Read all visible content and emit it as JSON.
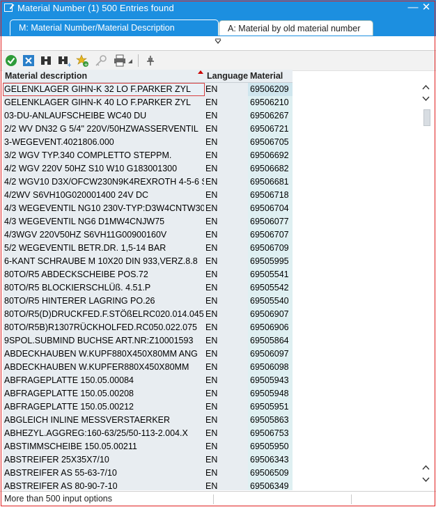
{
  "window": {
    "title": "Material Number (1)  500 Entries found",
    "minimize_glyph": "—",
    "close_glyph": "✕"
  },
  "tabs": [
    {
      "label": "M: Material Number/Material Description",
      "active": true
    },
    {
      "label": "A: Material by old material number",
      "active": false
    }
  ],
  "toolbar_icons": [
    "check-icon",
    "cancel-icon",
    "binoculars-icon",
    "find-next-icon",
    "add-favorite-icon",
    "key-icon",
    "print-icon",
    "dropdown-arrow-icon",
    "pin-icon"
  ],
  "colors": {
    "title_bar": "#1c8fe0",
    "material_column_bg": "#dff0f2",
    "sort_indicator": "#cc0000",
    "highlight_frame": "#e02020"
  },
  "table": {
    "headers": [
      "Material description",
      "Language",
      "Material"
    ],
    "sorted_column": "Material description",
    "rows": [
      [
        "GELENKLAGER GIHN-K 32 LO F.PARKER ZYL",
        "EN",
        "69506209"
      ],
      [
        "GELENKLAGER GIHN-K 40 LO F.PARKER ZYL",
        "EN",
        "69506210"
      ],
      [
        "03-DU-ANLAUFSCHEIBE WC40 DU",
        "EN",
        "69506267"
      ],
      [
        "2/2 WV DN32 G 5/4\" 220V/50HZWASSERVENTIL",
        "EN",
        "69506721"
      ],
      [
        "3-WEGEVENT.4021806.000",
        "EN",
        "69506705"
      ],
      [
        "3/2 WGV TYP.340 COMPLETTO STEPPM.",
        "EN",
        "69506692"
      ],
      [
        "4/2 WGV 220V 50HZ S10 W10 G183001300",
        "EN",
        "69506682"
      ],
      [
        "4/2 WGV10 D3X/OFCW230N9K4REXROTH 4-5-6 S",
        "EN",
        "69506681"
      ],
      [
        "4/2WV S6VH10G020001400 24V DC",
        "EN",
        "69506718"
      ],
      [
        "4/3 WEGEVENTIL NG10 230V-TYP:D3W4CNTW30",
        "EN",
        "69506704"
      ],
      [
        "4/3 WEGEVENTIL NG6 D1MW4CNJW75",
        "EN",
        "69506077"
      ],
      [
        "4/3WGV 220V50HZ S6VH11G00900160V",
        "EN",
        "69506707"
      ],
      [
        "5/2 WEGEVENTIL BETR.DR. 1,5-14 BAR",
        "EN",
        "69506709"
      ],
      [
        "6-KANT SCHRAUBE M 10X20 DIN 933,VERZ.8.8",
        "EN",
        "69505995"
      ],
      [
        "80TO/R5 ABDECKSCHEIBE POS.72",
        "EN",
        "69505541"
      ],
      [
        "80TO/R5 BLOCKIERSCHLÜß. 4.51.P",
        "EN",
        "69505542"
      ],
      [
        "80TO/R5 HINTERER LAGRING PO.26",
        "EN",
        "69505540"
      ],
      [
        "80TO/R5(D)DRUCKFED.F.STÖßELRC020.014.045",
        "EN",
        "69506907"
      ],
      [
        "80TO/R5B)R1307RÜCKHOLFED.RC050.022.075",
        "EN",
        "69506906"
      ],
      [
        "9SPOL.SUBMIND BUCHSE ART.NR:Z10001593",
        "EN",
        "69505864"
      ],
      [
        "ABDECKHAUBEN W.KUPF880X450X80MM ANG",
        "EN",
        "69506097"
      ],
      [
        "ABDECKHAUBEN W.KUPFER880X450X80MM",
        "EN",
        "69506098"
      ],
      [
        "ABFRAGEPLATTE 150.05.00084",
        "EN",
        "69505943"
      ],
      [
        "ABFRAGEPLATTE 150.05.00208",
        "EN",
        "69505948"
      ],
      [
        "ABFRAGEPLATTE 150.05.00212",
        "EN",
        "69505951"
      ],
      [
        "ABGLEICH INLINE MESSVERSTAERKER",
        "EN",
        "69505863"
      ],
      [
        "ABHEZYL.AGGREG:160-63/25/50-113-2.004.X",
        "EN",
        "69506753"
      ],
      [
        "ABSTIMMSCHEIBE 150.05.00211",
        "EN",
        "69505950"
      ],
      [
        "ABSTREIFER 25X35X7/10",
        "EN",
        "69506343"
      ],
      [
        "ABSTREIFER AS 55-63-7/10",
        "EN",
        "69506509"
      ],
      [
        "ABSTREIFER AS 80-90-7-10",
        "EN",
        "69506349"
      ]
    ]
  },
  "status_bar": {
    "text": "More than  500 input options"
  }
}
